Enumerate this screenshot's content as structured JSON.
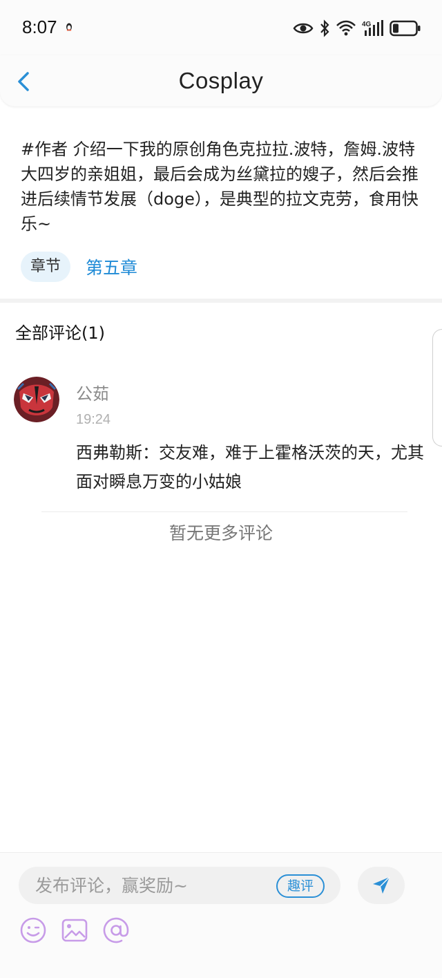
{
  "status": {
    "time": "8:07",
    "network": "4G"
  },
  "header": {
    "title": "Cosplay",
    "back_icon": "chevron-left-icon"
  },
  "post": {
    "text": "#作者 介绍一下我的原创角色克拉拉.波特，詹姆.波特大四岁的亲姐姐，最后会成为丝黛拉的嫂子，然后会推进后续情节发展（doge），是典型的拉文克劳，食用快乐~",
    "chip_label": "章节",
    "chapter_link": "第五章"
  },
  "comments": {
    "header": "全部评论(1)",
    "items": [
      {
        "name": "公茹",
        "time": "19:24",
        "text": "西弗勒斯：交友难，难于上霍格沃茨的天，尤其面对瞬息万变的小姑娘"
      }
    ],
    "no_more": "暂无更多评论"
  },
  "bottom": {
    "input_placeholder": "发布评论，赢奖励~",
    "quping_label": "趣评",
    "send_icon": "send-icon",
    "tools": [
      "emoji-icon",
      "image-icon",
      "at-icon"
    ]
  },
  "colors": {
    "accent": "#1e8ad6",
    "chip_bg": "#e7f3fb",
    "tool_icon": "#c79be8"
  }
}
